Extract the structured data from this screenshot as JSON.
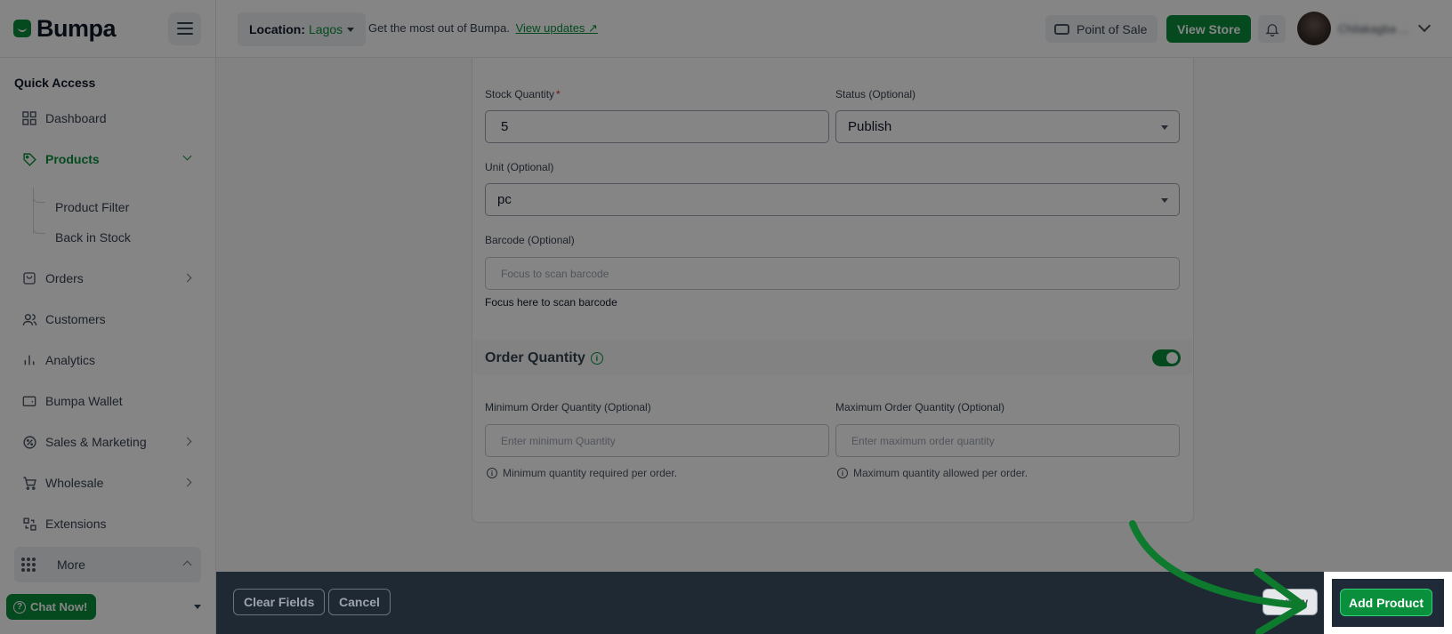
{
  "header": {
    "brand": "Bumpa",
    "location_label": "Location:",
    "location_value": "Lagos",
    "tagline": "Get the most out of Bumpa.",
    "updates_link": "View updates ↗",
    "pos_label": "Point of Sale",
    "view_store_label": "View Store",
    "user_name": "Chilakagba ..."
  },
  "sidebar": {
    "section_title": "Quick Access",
    "items": [
      {
        "label": "Dashboard",
        "icon": "dashboard-icon"
      },
      {
        "label": "Products",
        "icon": "tag-icon"
      },
      {
        "label": "Orders",
        "icon": "bag-icon"
      },
      {
        "label": "Customers",
        "icon": "users-icon"
      },
      {
        "label": "Analytics",
        "icon": "chart-icon"
      },
      {
        "label": "Bumpa Wallet",
        "icon": "wallet-icon"
      },
      {
        "label": "Sales & Marketing",
        "icon": "percent-icon"
      },
      {
        "label": "Wholesale",
        "icon": "cart-icon"
      },
      {
        "label": "Extensions",
        "icon": "puzzle-icon"
      }
    ],
    "products_sub": [
      "Product Filter",
      "Back in Stock"
    ],
    "more_label": "More",
    "chat_label": "Chat Now!"
  },
  "form": {
    "stock_label": "Stock Quantity",
    "stock_required": "*",
    "stock_value": "5",
    "status_label": "Status (Optional)",
    "status_value": "Publish",
    "unit_label": "Unit (Optional)",
    "unit_value": "pc",
    "barcode_label": "Barcode (Optional)",
    "barcode_placeholder": "Focus to scan barcode",
    "barcode_helper": "Focus here to scan barcode",
    "order_qty_title": "Order Quantity",
    "order_qty_enabled": true,
    "min_label": "Minimum Order Quantity (Optional)",
    "min_placeholder": "Enter minimum Quantity",
    "min_hint": "Minimum quantity required per order.",
    "max_label": "Maximum Order Quantity (Optional)",
    "max_placeholder": "Enter maximum order quantity",
    "max_hint": "Maximum quantity allowed per order."
  },
  "actions": {
    "clear_label": "Clear Fields",
    "cancel_label": "Cancel",
    "preview_label": "eview",
    "add_label": "Add Product"
  },
  "colors": {
    "brand": "#0a8f3c",
    "overlay_bar": "#1f2933"
  }
}
